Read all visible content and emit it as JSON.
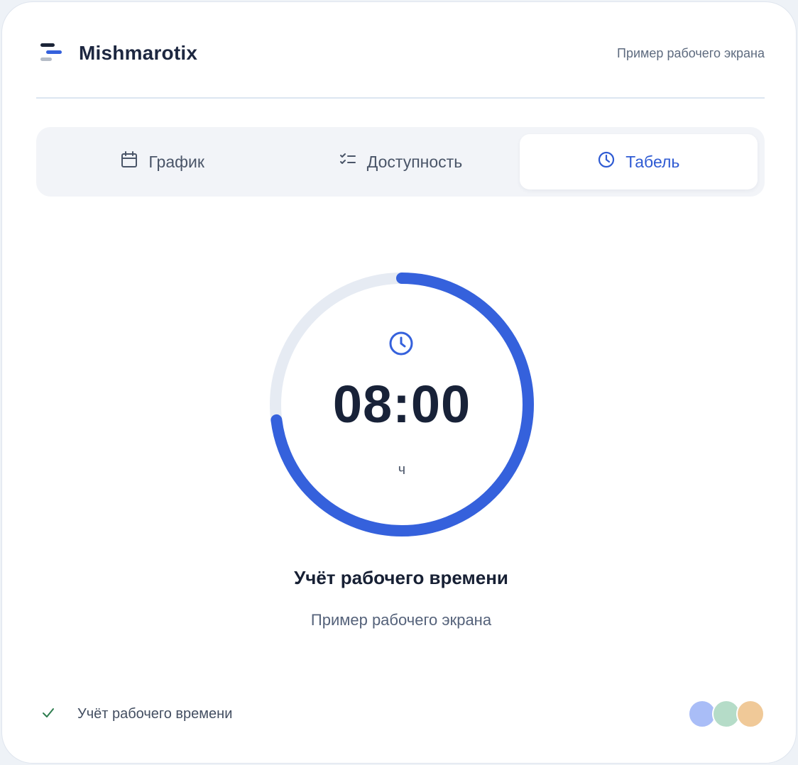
{
  "app": {
    "name": "Mishmarotix",
    "header_subtitle": "Пример рабочего экрана"
  },
  "tabs": [
    {
      "label": "График",
      "icon": "calendar-icon",
      "active": false
    },
    {
      "label": "Доступность",
      "icon": "checklist-icon",
      "active": false
    },
    {
      "label": "Табель",
      "icon": "clock-icon",
      "active": true
    }
  ],
  "timer": {
    "value": "08:00",
    "unit": "ч",
    "progress": 0.73,
    "icon": "clock-icon"
  },
  "main": {
    "title": "Учёт рабочего времени",
    "subtitle": "Пример рабочего экрана"
  },
  "footer": {
    "status_text": "Учёт рабочего времени",
    "status_icon": "check-icon",
    "avatar_colors": [
      "#a9bdf7",
      "#b5dcc8",
      "#f0c998"
    ]
  },
  "colors": {
    "accent": "#3561dc",
    "track": "#e6ebf3",
    "text_dark": "#182238"
  }
}
